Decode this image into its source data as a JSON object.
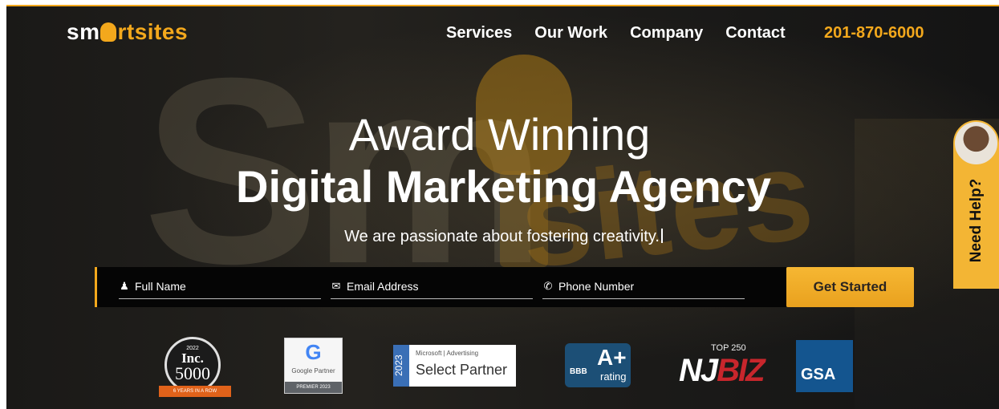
{
  "header": {
    "logo": {
      "part1": "sm",
      "part2": "rtsites"
    },
    "nav": [
      "Services",
      "Our Work",
      "Company",
      "Contact"
    ],
    "phone": "201-870-6000"
  },
  "hero": {
    "line1": "Award Winning",
    "line2": "Digital Marketing Agency",
    "tagline": "We are passionate about fostering creativity."
  },
  "form": {
    "name_placeholder": "Full Name",
    "email_placeholder": "Email Address",
    "phone_placeholder": "Phone Number",
    "submit_label": "Get Started"
  },
  "help": {
    "label": "Need Help?"
  },
  "badges": {
    "inc": {
      "year": "2022",
      "title": "Inc.",
      "number": "5000",
      "ribbon": "6 YEARS IN A ROW"
    },
    "google": {
      "letter": "G",
      "label": "Google Partner",
      "sub": "PREMIER 2023"
    },
    "microsoft": {
      "year": "2023",
      "top": "Microsoft | Advertising",
      "label": "Select Partner"
    },
    "bbb": {
      "grade": "A+",
      "rating": "rating",
      "mark": "BBB"
    },
    "njbiz": {
      "top": "TOP 250",
      "nj": "NJ",
      "biz": "BIZ"
    },
    "gsa": {
      "label": "GSA"
    }
  },
  "colors": {
    "accent": "#f3a81c",
    "cta": "#f0ac29",
    "background": "#1c1b19"
  },
  "icons": [
    "user-icon",
    "envelope-icon",
    "phone-icon",
    "avatar"
  ]
}
